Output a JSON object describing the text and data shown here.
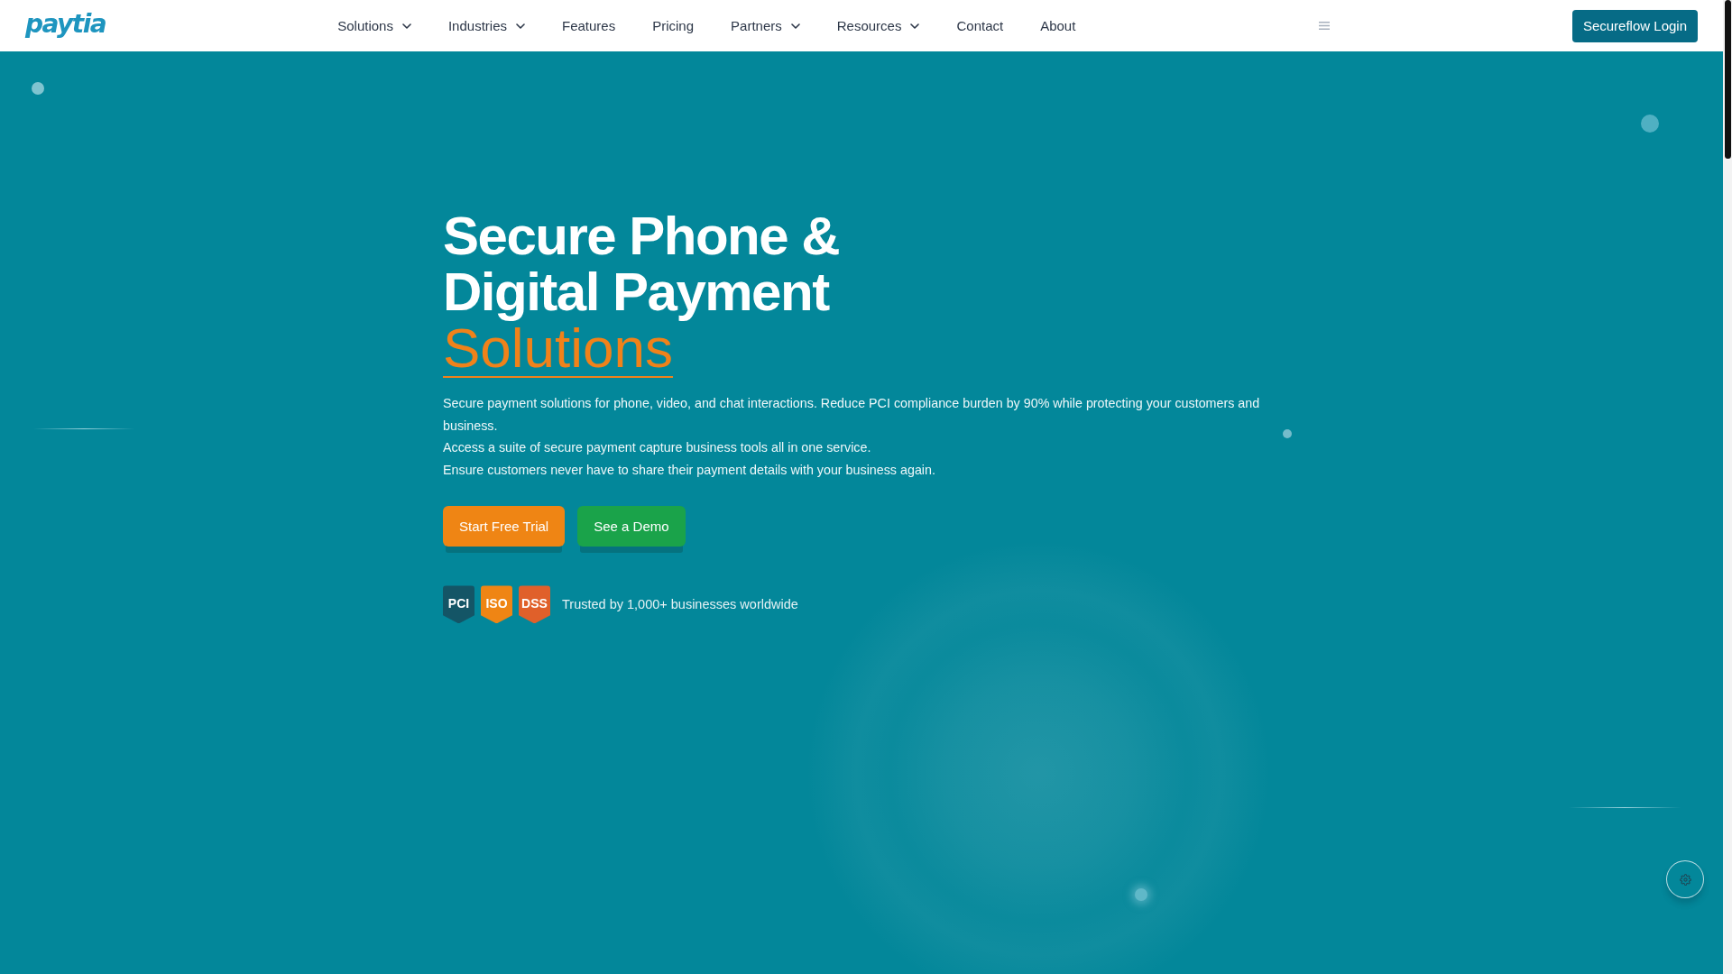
{
  "nav": {
    "logo": "paytia",
    "items": [
      {
        "label": "Solutions",
        "has_dropdown": true
      },
      {
        "label": "Industries",
        "has_dropdown": true
      },
      {
        "label": "Features",
        "has_dropdown": false
      },
      {
        "label": "Pricing",
        "has_dropdown": false
      },
      {
        "label": "Partners",
        "has_dropdown": true
      },
      {
        "label": "Resources",
        "has_dropdown": true
      },
      {
        "label": "Contact",
        "has_dropdown": false
      },
      {
        "label": "About",
        "has_dropdown": false
      }
    ],
    "login_button": "Secureflow Login"
  },
  "hero": {
    "heading": "Secure Phone & Digital Payment",
    "heading_highlight": "Solutions",
    "paragraphs": [
      "Secure payment solutions for phone, video, and chat interactions. Reduce PCI compliance burden by 90% while protecting your customers and business.",
      "Access a suite of secure payment capture business tools all in one service.",
      "Ensure customers never have to share their payment details with your business again."
    ],
    "buttons": [
      {
        "label": "Start Free Trial",
        "kind": "primary"
      },
      {
        "label": "See a Demo",
        "kind": "secondary"
      }
    ],
    "badges": [
      {
        "label": "PCI",
        "color": "#145566"
      },
      {
        "label": "ISO",
        "color": "#ef8514"
      },
      {
        "label": "DSS",
        "color": "#e0602a"
      }
    ],
    "trust_text": "Trusted by 1,000+ businesses worldwide"
  }
}
